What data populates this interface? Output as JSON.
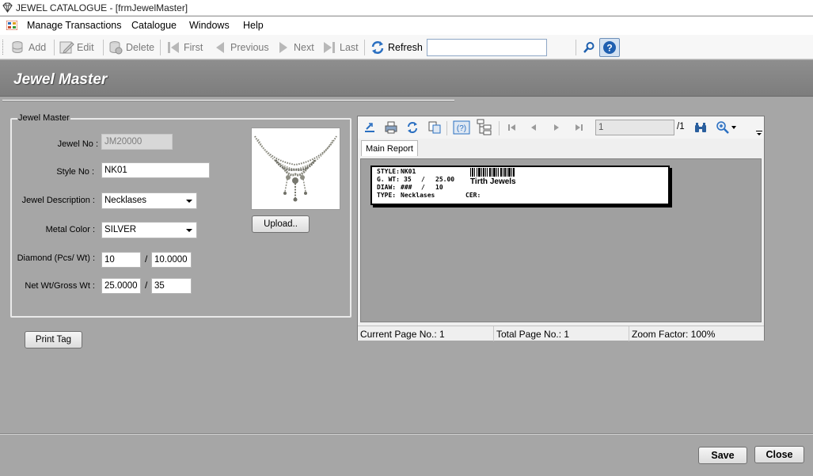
{
  "window": {
    "title": "JEWEL CATALOGUE - [frmJewelMaster]"
  },
  "menu": {
    "items": [
      "Manage Transactions",
      "Catalogue",
      "Windows",
      "Help"
    ]
  },
  "toolbar": {
    "add": "Add",
    "edit": "Edit",
    "delete": "Delete",
    "first": "First",
    "previous": "Previous",
    "next": "Next",
    "last": "Last",
    "refresh": "Refresh",
    "search_value": ""
  },
  "header": {
    "title": "Jewel Master"
  },
  "form": {
    "group_title": "Jewel Master",
    "jewel_no_label": "Jewel No :",
    "jewel_no_value": "JM20000",
    "style_no_label": "Style No :",
    "style_no_value": "NK01",
    "description_label": "Jewel Description :",
    "description_value": "Necklases",
    "metal_color_label": "Metal Color :",
    "metal_color_value": "SILVER",
    "diamond_label": "Diamond (Pcs/ Wt) :",
    "diamond_pcs": "10",
    "diamond_wt": "10.0000",
    "weight_label": "Net Wt/Gross Wt :",
    "net_wt": "25.0000",
    "gross_wt": "35",
    "slash": "/",
    "upload_label": "Upload..",
    "print_tag_label": "Print Tag"
  },
  "report_viewer": {
    "page_value": "1",
    "page_total": "/1",
    "tab_label": "Main Report",
    "tag": {
      "style_label": "STYLE:",
      "style_value": "NK01",
      "gwt_label": "G. WT:",
      "gwt_value": "35",
      "gwt_sep": "/",
      "gwt_value2": "25.00",
      "diaw_label": "DIAW:",
      "diaw_value": "###",
      "diaw_sep": "/",
      "diaw_value2": "10",
      "type_label": "TYPE:",
      "type_value": "Necklases",
      "shop_name": "Tirth Jewels",
      "cer_label": "CER:"
    },
    "status": {
      "current_page": "Current Page No.: 1",
      "total_page": "Total Page No.: 1",
      "zoom": "Zoom Factor: 100%"
    }
  },
  "footer": {
    "save": "Save",
    "close": "Close"
  },
  "icons": {
    "app": "diamond-icon",
    "menu": "mdi-menu-icon",
    "add": "database-add-icon",
    "edit": "edit-icon",
    "delete": "database-delete-icon",
    "first": "first-arrow-icon",
    "previous": "previous-arrow-icon",
    "next": "next-arrow-icon",
    "last": "last-arrow-icon",
    "refresh": "refresh-icon",
    "search": "search-icon",
    "help": "help-icon"
  },
  "colors": {
    "background": "#a6a6a6",
    "header_band": "#868686",
    "accent_blue": "#2a6fc1"
  }
}
